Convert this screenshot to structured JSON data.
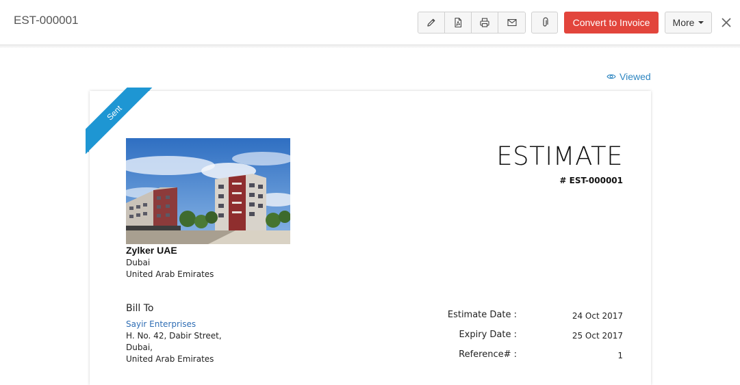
{
  "header": {
    "doc_id": "EST-000001",
    "convert_label": "Convert to Invoice",
    "more_label": "More",
    "icons": [
      "pencil-icon",
      "pdf-icon",
      "printer-icon",
      "mail-icon",
      "paperclip-icon",
      "close-icon",
      "chevron-down-icon"
    ]
  },
  "status": {
    "viewed_label": "Viewed",
    "ribbon_label": "Sent"
  },
  "colors": {
    "accent_red": "#e2453c",
    "ribbon_blue": "#1e96d3",
    "link_blue": "#2e86c1"
  },
  "document": {
    "title": "ESTIMATE",
    "number": "# EST-000001",
    "company": {
      "name": "Zylker UAE",
      "city": "Dubai",
      "country": "United Arab Emirates"
    },
    "bill_to": {
      "label": "Bill To",
      "client": "Sayir Enterprises",
      "address_line1": "H. No. 42, Dabir Street,",
      "address_line2": "Dubai,",
      "address_line3": "United Arab Emirates"
    },
    "meta": {
      "estimate_date_label": "Estimate Date :",
      "estimate_date": "24 Oct 2017",
      "expiry_date_label": "Expiry Date :",
      "expiry_date": "25 Oct 2017",
      "reference_label": "Reference# :",
      "reference": "1"
    }
  }
}
